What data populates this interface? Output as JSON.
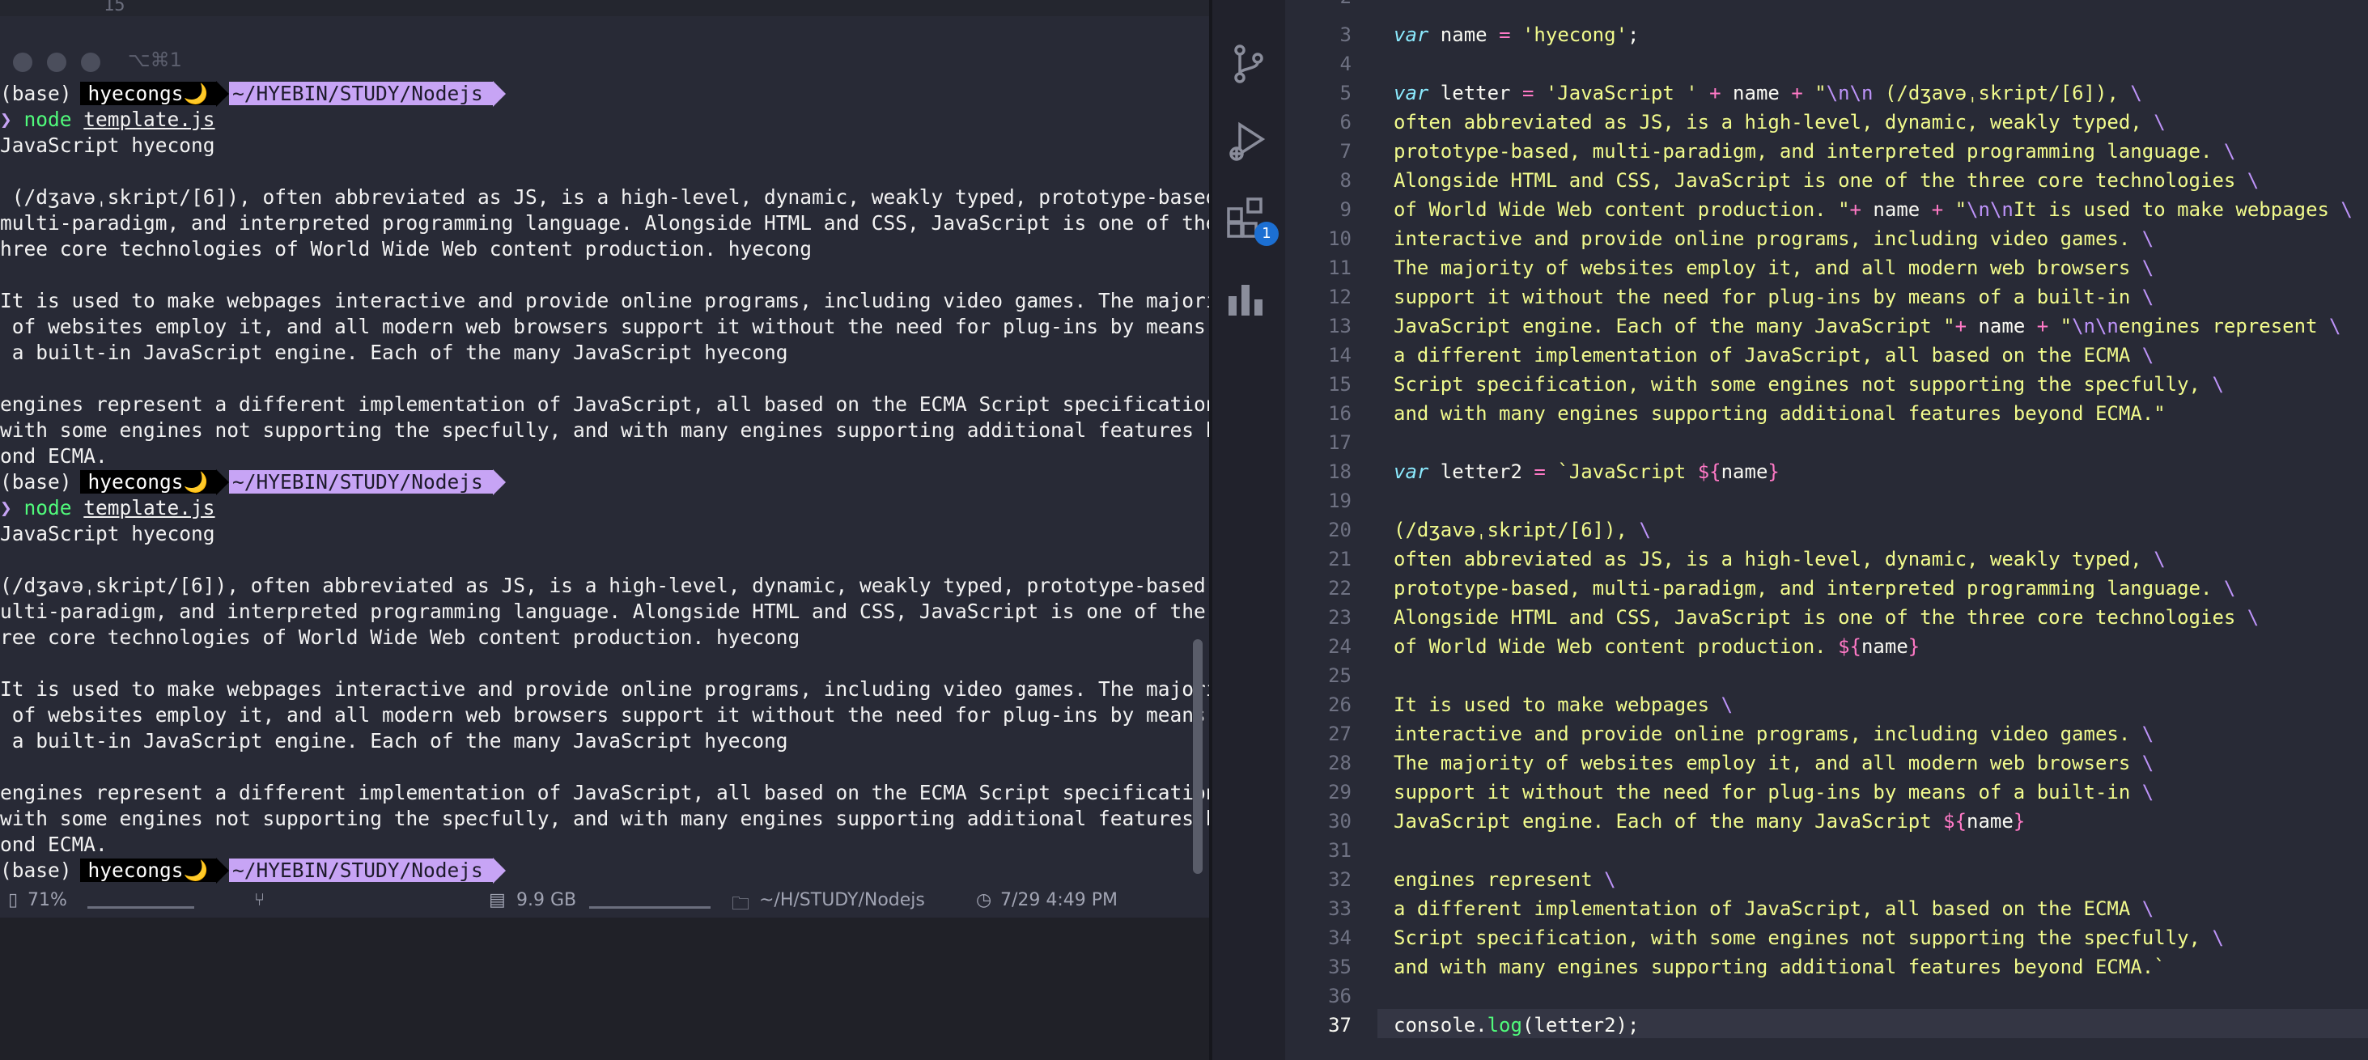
{
  "terminal": {
    "top_partial_number": "15",
    "tab_shortcut": "⌥⌘1",
    "prompt": {
      "env": "(base)",
      "user": "hyecongs🌙",
      "path": "~/HYEBIN/STUDY/Nodejs"
    },
    "command": {
      "cmd": "node",
      "arg": "template.js"
    },
    "output1": [
      "JavaScript hyecong",
      "",
      " (/dʒavəˌskript/[6]), often abbreviated as JS, is a high-level, dynamic, weakly typed, prototype-based,",
      "multi-paradigm, and interpreted programming language. Alongside HTML and CSS, JavaScript is one of the t",
      "hree core technologies of World Wide Web content production. hyecong",
      "",
      "It is used to make webpages interactive and provide online programs, including video games. The majority",
      " of websites employ it, and all modern web browsers support it without the need for plug-ins by means of",
      " a built-in JavaScript engine. Each of the many JavaScript hyecong",
      "",
      "engines represent a different implementation of JavaScript, all based on the ECMA Script specification,",
      "with some engines not supporting the specfully, and with many engines supporting additional features bey",
      "ond ECMA."
    ],
    "output2": [
      "JavaScript hyecong",
      "",
      "(/dʒavəˌskript/[6]), often abbreviated as JS, is a high-level, dynamic, weakly typed, prototype-based, m",
      "ulti-paradigm, and interpreted programming language. Alongside HTML and CSS, JavaScript is one of the th",
      "ree core technologies of World Wide Web content production. hyecong",
      "",
      "It is used to make webpages interactive and provide online programs, including video games. The majority",
      " of websites employ it, and all modern web browsers support it without the need for plug-ins by means of",
      " a built-in JavaScript engine. Each of the many JavaScript hyecong",
      "",
      "engines represent a different implementation of JavaScript, all based on the ECMA Script specification,",
      "with some engines not supporting the specfully, and with many engines supporting additional features bey",
      "ond ECMA."
    ],
    "statusbar": {
      "battery": "71%",
      "memory": "9.9 GB",
      "folder": "~/H/STUDY/Nodejs",
      "datetime": "7/29 4:49 PM"
    }
  },
  "editor": {
    "top_partial_line_number": "2",
    "extensions_badge": "1",
    "current_line": 37,
    "lines": [
      {
        "n": "3",
        "tokens": [
          [
            "kw",
            "var"
          ],
          [
            "p",
            " name "
          ],
          [
            "op",
            "="
          ],
          [
            "p",
            " "
          ],
          [
            "str",
            "'hyecong'"
          ],
          [
            "p",
            ";"
          ]
        ]
      },
      {
        "n": "4",
        "tokens": []
      },
      {
        "n": "5",
        "tokens": [
          [
            "kw",
            "var"
          ],
          [
            "p",
            " letter "
          ],
          [
            "op",
            "="
          ],
          [
            "p",
            " "
          ],
          [
            "str",
            "'JavaScript '"
          ],
          [
            "p",
            " "
          ],
          [
            "op",
            "+"
          ],
          [
            "p",
            " name "
          ],
          [
            "op",
            "+"
          ],
          [
            "p",
            " "
          ],
          [
            "str",
            "\""
          ],
          [
            "esc",
            "\\n\\n"
          ],
          [
            "str",
            " (/dʒavəˌskript/[6]), "
          ],
          [
            "esc",
            "\\"
          ]
        ]
      },
      {
        "n": "6",
        "tokens": [
          [
            "str",
            "often abbreviated as JS, is a high-level, dynamic, weakly typed, "
          ],
          [
            "esc",
            "\\"
          ]
        ]
      },
      {
        "n": "7",
        "tokens": [
          [
            "str",
            "prototype-based, multi-paradigm, and interpreted programming language. "
          ],
          [
            "esc",
            "\\"
          ]
        ]
      },
      {
        "n": "8",
        "tokens": [
          [
            "str",
            "Alongside HTML and CSS, JavaScript is one of the three core technologies "
          ],
          [
            "esc",
            "\\"
          ]
        ]
      },
      {
        "n": "9",
        "tokens": [
          [
            "str",
            "of World Wide Web content production. \""
          ],
          [
            "op",
            "+"
          ],
          [
            "p",
            " name "
          ],
          [
            "op",
            "+"
          ],
          [
            "p",
            " "
          ],
          [
            "str",
            "\""
          ],
          [
            "esc",
            "\\n\\n"
          ],
          [
            "str",
            "It is used to make webpages "
          ],
          [
            "esc",
            "\\"
          ]
        ]
      },
      {
        "n": "10",
        "tokens": [
          [
            "str",
            "interactive and provide online programs, including video games. "
          ],
          [
            "esc",
            "\\"
          ]
        ]
      },
      {
        "n": "11",
        "tokens": [
          [
            "str",
            "The majority of websites employ it, and all modern web browsers "
          ],
          [
            "esc",
            "\\"
          ]
        ]
      },
      {
        "n": "12",
        "tokens": [
          [
            "str",
            "support it without the need for plug-ins by means of a built-in "
          ],
          [
            "esc",
            "\\"
          ]
        ]
      },
      {
        "n": "13",
        "tokens": [
          [
            "str",
            "JavaScript engine. Each of the many JavaScript \""
          ],
          [
            "op",
            "+"
          ],
          [
            "p",
            " name "
          ],
          [
            "op",
            "+"
          ],
          [
            "p",
            " "
          ],
          [
            "str",
            "\""
          ],
          [
            "esc",
            "\\n\\n"
          ],
          [
            "str",
            "engines represent "
          ],
          [
            "esc",
            "\\"
          ]
        ]
      },
      {
        "n": "14",
        "tokens": [
          [
            "str",
            "a different implementation of JavaScript, all based on the ECMA "
          ],
          [
            "esc",
            "\\"
          ]
        ]
      },
      {
        "n": "15",
        "tokens": [
          [
            "str",
            "Script specification, with some engines not supporting the specfully, "
          ],
          [
            "esc",
            "\\"
          ]
        ]
      },
      {
        "n": "16",
        "tokens": [
          [
            "str",
            "and with many engines supporting additional features beyond ECMA.\""
          ]
        ]
      },
      {
        "n": "17",
        "tokens": []
      },
      {
        "n": "18",
        "tokens": [
          [
            "kw",
            "var"
          ],
          [
            "p",
            " letter2 "
          ],
          [
            "op",
            "="
          ],
          [
            "p",
            " "
          ],
          [
            "str",
            "`JavaScript "
          ],
          [
            "op",
            "${"
          ],
          [
            "p",
            "name"
          ],
          [
            "op",
            "}"
          ]
        ]
      },
      {
        "n": "19",
        "tokens": []
      },
      {
        "n": "20",
        "tokens": [
          [
            "str",
            "(/dʒavəˌskript/[6]), "
          ],
          [
            "esc",
            "\\"
          ]
        ]
      },
      {
        "n": "21",
        "tokens": [
          [
            "str",
            "often abbreviated as JS, is a high-level, dynamic, weakly typed, "
          ],
          [
            "esc",
            "\\"
          ]
        ]
      },
      {
        "n": "22",
        "tokens": [
          [
            "str",
            "prototype-based, multi-paradigm, and interpreted programming language. "
          ],
          [
            "esc",
            "\\"
          ]
        ]
      },
      {
        "n": "23",
        "tokens": [
          [
            "str",
            "Alongside HTML and CSS, JavaScript is one of the three core technologies "
          ],
          [
            "esc",
            "\\"
          ]
        ]
      },
      {
        "n": "24",
        "tokens": [
          [
            "str",
            "of World Wide Web content production. "
          ],
          [
            "op",
            "${"
          ],
          [
            "p",
            "name"
          ],
          [
            "op",
            "}"
          ]
        ]
      },
      {
        "n": "25",
        "tokens": []
      },
      {
        "n": "26",
        "tokens": [
          [
            "str",
            "It is used to make webpages "
          ],
          [
            "esc",
            "\\"
          ]
        ]
      },
      {
        "n": "27",
        "tokens": [
          [
            "str",
            "interactive and provide online programs, including video games. "
          ],
          [
            "esc",
            "\\"
          ]
        ]
      },
      {
        "n": "28",
        "tokens": [
          [
            "str",
            "The majority of websites employ it, and all modern web browsers "
          ],
          [
            "esc",
            "\\"
          ]
        ]
      },
      {
        "n": "29",
        "tokens": [
          [
            "str",
            "support it without the need for plug-ins by means of a built-in "
          ],
          [
            "esc",
            "\\"
          ]
        ]
      },
      {
        "n": "30",
        "tokens": [
          [
            "str",
            "JavaScript engine. Each of the many JavaScript "
          ],
          [
            "op",
            "${"
          ],
          [
            "p",
            "name"
          ],
          [
            "op",
            "}"
          ]
        ]
      },
      {
        "n": "31",
        "tokens": []
      },
      {
        "n": "32",
        "tokens": [
          [
            "str",
            "engines represent "
          ],
          [
            "esc",
            "\\"
          ]
        ]
      },
      {
        "n": "33",
        "tokens": [
          [
            "str",
            "a different implementation of JavaScript, all based on the ECMA "
          ],
          [
            "esc",
            "\\"
          ]
        ]
      },
      {
        "n": "34",
        "tokens": [
          [
            "str",
            "Script specification, with some engines not supporting the specfully, "
          ],
          [
            "esc",
            "\\"
          ]
        ]
      },
      {
        "n": "35",
        "tokens": [
          [
            "str",
            "and with many engines supporting additional features beyond ECMA.`"
          ]
        ]
      },
      {
        "n": "36",
        "tokens": []
      },
      {
        "n": "37",
        "tokens": [
          [
            "p",
            "console."
          ],
          [
            "fn",
            "log"
          ],
          [
            "p",
            "(letter2);"
          ]
        ]
      }
    ]
  }
}
